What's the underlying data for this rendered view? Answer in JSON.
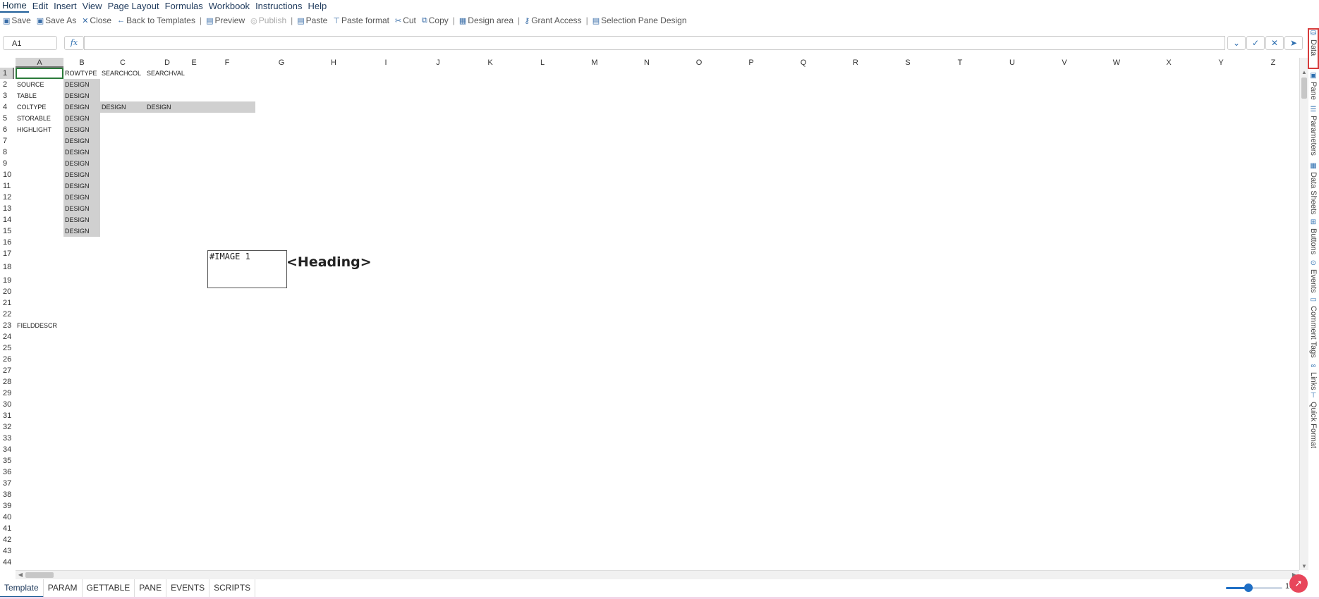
{
  "menubar": {
    "items": [
      "Home",
      "Edit",
      "Insert",
      "View",
      "Page Layout",
      "Formulas",
      "Workbook",
      "Instructions",
      "Help"
    ]
  },
  "toolbar": {
    "save": "Save",
    "save_as": "Save As",
    "close": "Close",
    "back": "Back to Templates",
    "preview": "Preview",
    "publish": "Publish",
    "paste": "Paste",
    "paste_format": "Paste format",
    "cut": "Cut",
    "copy": "Copy",
    "design_area": "Design area",
    "grant_access": "Grant Access",
    "selection_pane_design": "Selection Pane Design"
  },
  "formula_bar": {
    "name_box": "A1",
    "fx": "fx",
    "value": ""
  },
  "columns": [
    "A",
    "B",
    "C",
    "D",
    "E",
    "F",
    "G",
    "H",
    "I",
    "J",
    "K",
    "L",
    "M",
    "N",
    "O",
    "P",
    "Q",
    "R",
    "S",
    "T",
    "U",
    "V",
    "W",
    "X",
    "Y",
    "Z"
  ],
  "rows": [
    "1",
    "2",
    "3",
    "4",
    "5",
    "6",
    "7",
    "8",
    "9",
    "10",
    "11",
    "12",
    "13",
    "14",
    "15",
    "16",
    "17",
    "18",
    "19",
    "20",
    "21",
    "22",
    "23",
    "24",
    "25",
    "26",
    "27",
    "28",
    "29",
    "30",
    "31",
    "32",
    "33",
    "34",
    "35",
    "36",
    "37",
    "38",
    "39",
    "40",
    "41",
    "42",
    "43",
    "44"
  ],
  "cells": {
    "B1": "ROWTYPE",
    "C1": "SEARCHCOL",
    "D1": "SEARCHVAL",
    "A2": "SOURCE",
    "A3": "TABLE",
    "A4": "COLTYPE",
    "A5": "STORABLE",
    "A6": "HIGHLIGHT",
    "C4": "DESIGN",
    "D4": "DESIGN",
    "design": "DESIGN",
    "A23": "FIELDDESCR"
  },
  "image_placeholder": "#IMAGE 1",
  "heading": "<Heading>",
  "sheet_tabs": [
    "Template",
    "PARAM",
    "GETTABLE",
    "PANE",
    "EVENTS",
    "SCRIPTS"
  ],
  "active_tab": "Template",
  "zoom": {
    "label": "10",
    "level_fraction": 0.4
  },
  "sidebar": {
    "data": "Data",
    "pane": "Pane",
    "parameters": "Parameters",
    "data_sheets": "Data Sheets",
    "buttons": "Buttons",
    "events": "Events",
    "comment_tags": "Comment Tags",
    "links": "Links",
    "quick_format": "Quick Format"
  },
  "colors": {
    "accent": "#2e6fb0",
    "design_fill": "#d0d0d0",
    "active_cell": "#2b7a3a",
    "highlight_border": "#d63b3b"
  }
}
